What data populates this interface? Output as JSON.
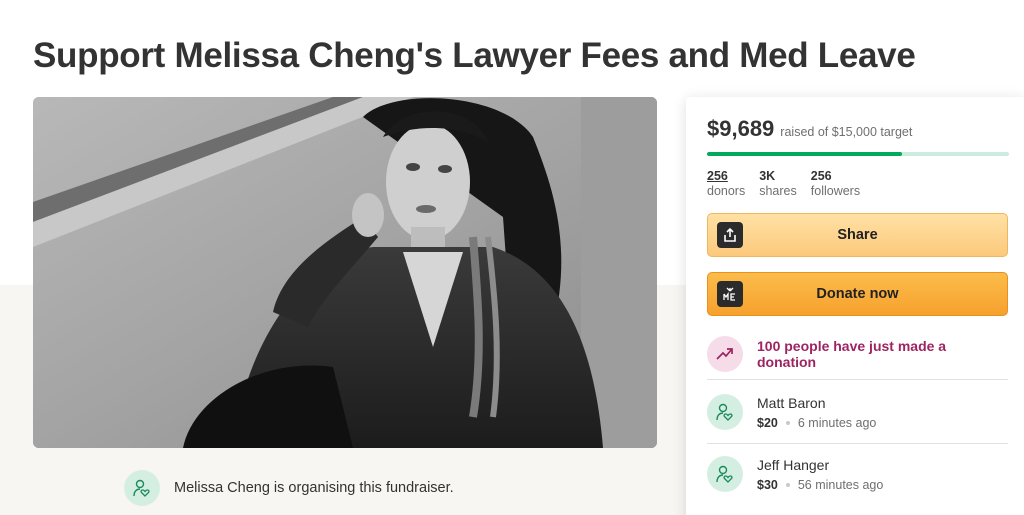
{
  "page": {
    "title": "Support Melissa Cheng's Lawyer Fees and Med Leave"
  },
  "hero": {
    "icon": "fundraiser-cover-photo"
  },
  "organiser": {
    "text": "Melissa Cheng is organising this fundraiser.",
    "icon": "user-heart-icon"
  },
  "summary": {
    "raised": "$9,689",
    "target_text": "raised of $15,000 target",
    "progress_fraction": 0.646,
    "stats": [
      {
        "value": "256",
        "label": "donors"
      },
      {
        "value": "3K",
        "label": "shares"
      },
      {
        "value": "256",
        "label": "followers"
      }
    ]
  },
  "buttons": {
    "share_label": "Share",
    "share_icon": "share-upload-icon",
    "donate_label": "Donate now",
    "donate_icon": "donate-heart-icon"
  },
  "recent_activity": {
    "text": "100 people have just made a donation",
    "icon": "trending-up-icon"
  },
  "donations": [
    {
      "name": "Matt Baron",
      "amount": "$20",
      "time": "6 minutes ago"
    },
    {
      "name": "Jeff Hanger",
      "amount": "$30",
      "time": "56 minutes ago"
    }
  ],
  "colors": {
    "progress": "#02a95c",
    "progress_track": "#cdebdf",
    "share_button": "#fcc97c",
    "donate_button": "#f6a12e",
    "activity_text": "#9e2461",
    "avatar_bg": "#d4efe2"
  }
}
